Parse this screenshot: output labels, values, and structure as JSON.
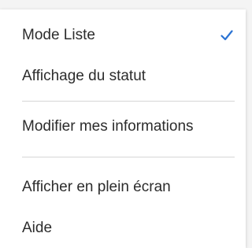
{
  "menu": {
    "items": [
      {
        "label": "Mode Liste",
        "checked": true
      },
      {
        "label": "Affichage du statut",
        "checked": false
      },
      {
        "label": "Modifier mes informations",
        "checked": false
      },
      {
        "label": "Afficher en plein écran",
        "checked": false
      },
      {
        "label": "Aide",
        "checked": false
      }
    ],
    "check_icon": "check-icon",
    "accent_color": "#2b73d3"
  }
}
